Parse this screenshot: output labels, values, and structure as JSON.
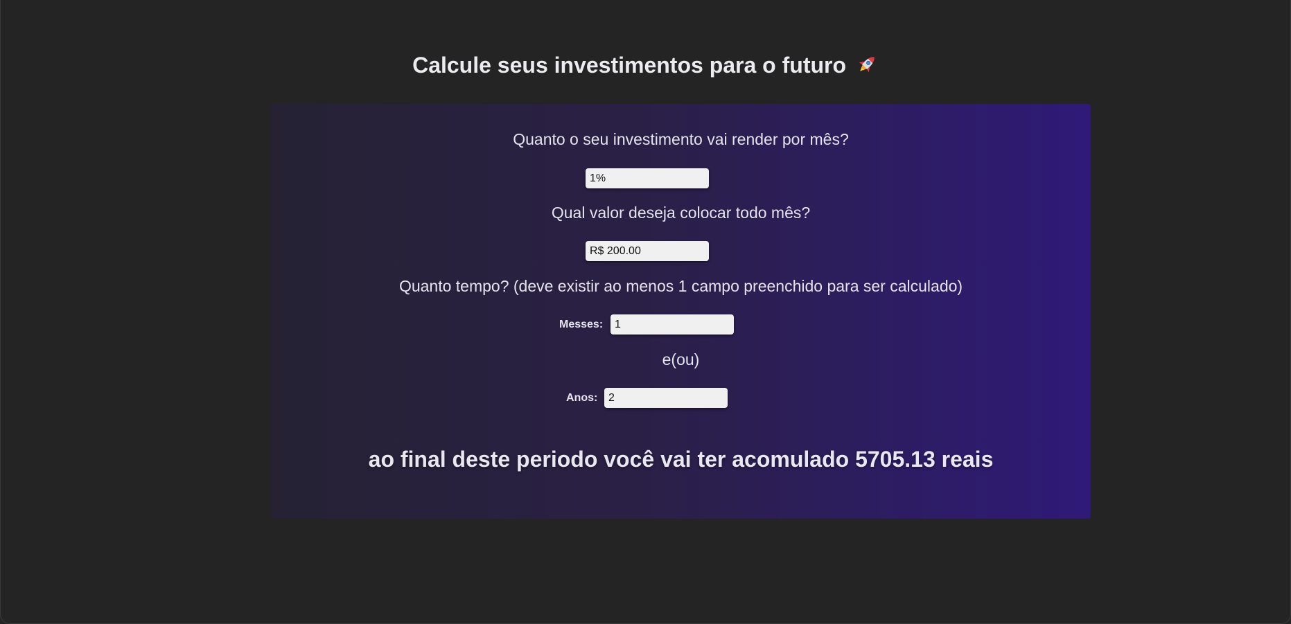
{
  "header": {
    "title": "Calcule seus investimentos para o futuro",
    "title_icon": "rocket-icon"
  },
  "form": {
    "rate": {
      "label": "Quanto o seu investimento vai render por mês?",
      "value": "1%"
    },
    "monthly_deposit": {
      "label": "Qual valor deseja colocar todo mês?",
      "value": "R$ 200.00"
    },
    "period": {
      "label": "Quanto tempo? (deve existir ao menos 1 campo preenchido para ser calculado)",
      "months_label": "Messes:",
      "months_value": "1",
      "separator": "e(ou)",
      "years_label": "Anos:",
      "years_value": "2"
    }
  },
  "result": {
    "text": "ao final deste periodo você vai ter acomulado 5705.13 reais"
  },
  "colors": {
    "background": "#242424",
    "card_gradient_start": "#262234",
    "card_gradient_end": "#2f1a78",
    "input_bg": "#f0f0f0"
  }
}
